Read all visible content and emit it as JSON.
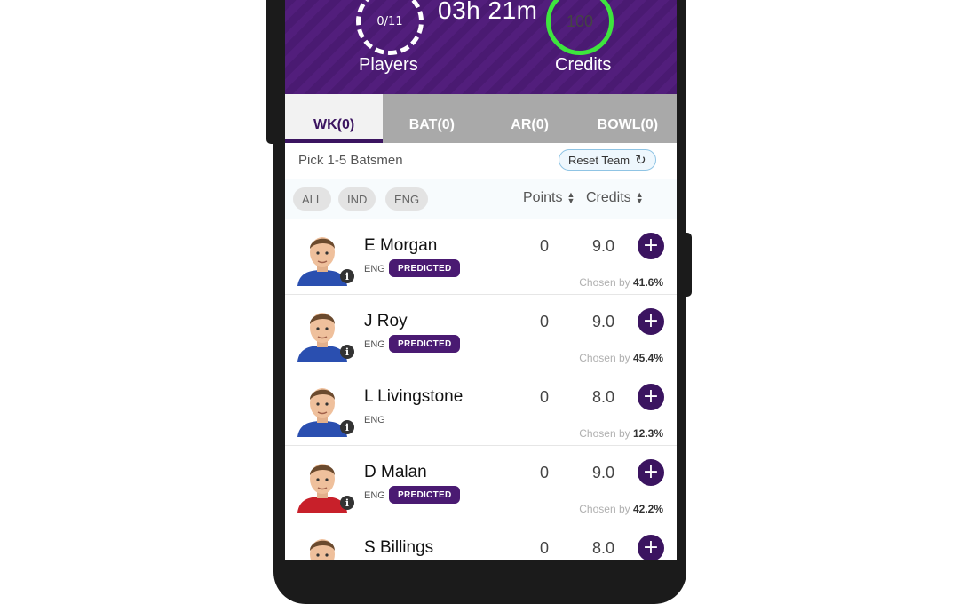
{
  "header": {
    "players_count": "0/11",
    "players_label": "Players",
    "timer": "03h 21m",
    "credits_value": "100",
    "credits_label": "Credits",
    "credits_ring_color": "#3ee53e",
    "background_color": "#4a1a72"
  },
  "tabs": [
    {
      "label": "WK(0)",
      "active": true
    },
    {
      "label": "BAT(0)",
      "active": false
    },
    {
      "label": "AR(0)",
      "active": false
    },
    {
      "label": "BOWL(0)",
      "active": false
    }
  ],
  "pick": {
    "text": "Pick 1-5 Batsmen",
    "reset_label": "Reset Team",
    "reset_icon": "refresh-icon"
  },
  "filters": {
    "chips": [
      "ALL",
      "IND",
      "ENG"
    ],
    "sort_points": "Points",
    "sort_credits": "Credits"
  },
  "players": [
    {
      "name": "E Morgan",
      "team": "ENG",
      "predicted": "PREDICTED",
      "points": "0",
      "credits": "9.0",
      "chosen_prefix": "Chosen by",
      "chosen_pct": "41.6%",
      "shirt": "#2a4fb0"
    },
    {
      "name": "J Roy",
      "team": "ENG",
      "predicted": "PREDICTED",
      "points": "0",
      "credits": "9.0",
      "chosen_prefix": "Chosen by",
      "chosen_pct": "45.4%",
      "shirt": "#2a4fb0"
    },
    {
      "name": "L Livingstone",
      "team": "ENG",
      "predicted": "",
      "points": "0",
      "credits": "8.0",
      "chosen_prefix": "Chosen by",
      "chosen_pct": "12.3%",
      "shirt": "#2a4fb0"
    },
    {
      "name": "D Malan",
      "team": "ENG",
      "predicted": "PREDICTED",
      "points": "0",
      "credits": "9.0",
      "chosen_prefix": "Chosen by",
      "chosen_pct": "42.2%",
      "shirt": "#c8202a"
    },
    {
      "name": "S Billings",
      "team": "",
      "predicted": "",
      "points": "0",
      "credits": "8.0",
      "chosen_prefix": "",
      "chosen_pct": "",
      "shirt": "#2a4fb0"
    }
  ],
  "add_label": "+",
  "info_label": "i"
}
